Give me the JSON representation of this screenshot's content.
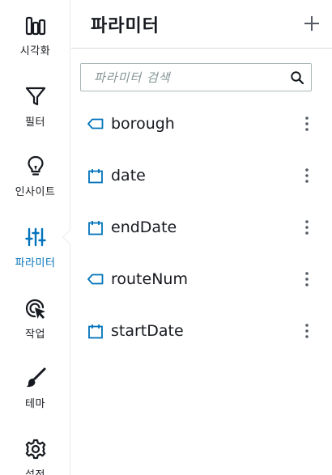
{
  "rail": {
    "items": [
      {
        "label": "시각화",
        "icon": "bar-chart-icon"
      },
      {
        "label": "필터",
        "icon": "filter-icon"
      },
      {
        "label": "인사이트",
        "icon": "lightbulb-icon"
      },
      {
        "label": "파라미터",
        "icon": "sliders-icon",
        "active": true
      },
      {
        "label": "작업",
        "icon": "cursor-target-icon"
      },
      {
        "label": "테마",
        "icon": "brush-icon"
      },
      {
        "label": "설정",
        "icon": "gear-icon"
      }
    ]
  },
  "panel": {
    "title": "파라미터",
    "add_icon": "plus-icon"
  },
  "search": {
    "placeholder": "파라미터 검색",
    "value": ""
  },
  "parameters": [
    {
      "name": "borough",
      "type": "string",
      "icon": "tag-icon"
    },
    {
      "name": "date",
      "type": "datetime",
      "icon": "calendar-icon"
    },
    {
      "name": "endDate",
      "type": "datetime",
      "icon": "calendar-icon"
    },
    {
      "name": "routeNum",
      "type": "string",
      "icon": "tag-icon"
    },
    {
      "name": "startDate",
      "type": "datetime",
      "icon": "calendar-icon"
    }
  ],
  "colors": {
    "accent": "#0073bb",
    "text": "#16191f",
    "border": "#d5dbdb",
    "placeholder": "#879596"
  }
}
